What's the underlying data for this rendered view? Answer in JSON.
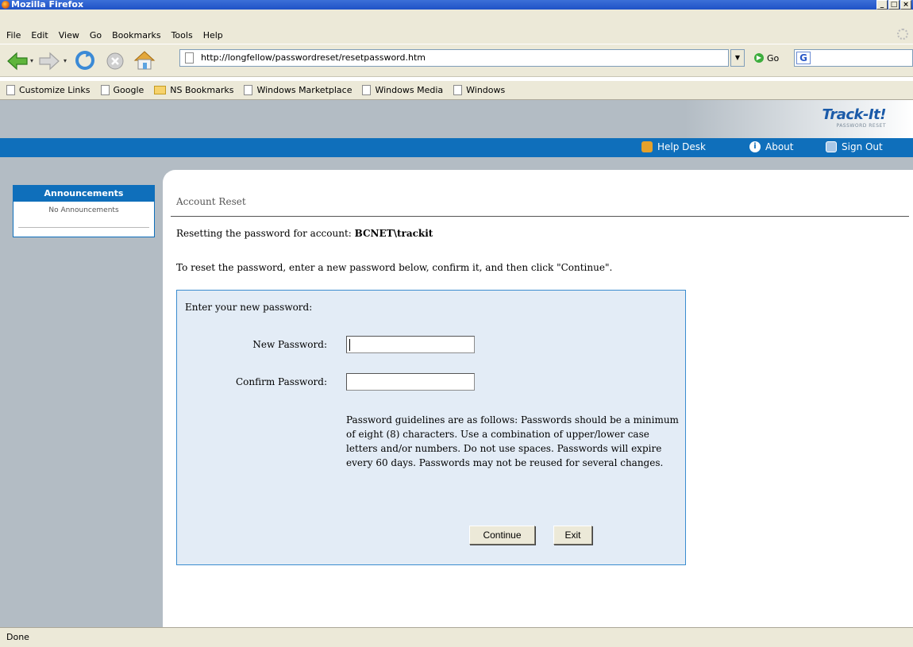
{
  "window": {
    "title": "Mozilla Firefox"
  },
  "menu": {
    "items": [
      "File",
      "Edit",
      "View",
      "Go",
      "Bookmarks",
      "Tools",
      "Help"
    ]
  },
  "nav": {
    "url": "http://longfellow/passwordreset/resetpassword.htm",
    "go_label": "Go",
    "search_value": ""
  },
  "bookmarks": [
    {
      "label": "Customize Links",
      "icon": "page-icon"
    },
    {
      "label": "Google",
      "icon": "page-icon"
    },
    {
      "label": "NS Bookmarks",
      "icon": "folder-icon"
    },
    {
      "label": "Windows Marketplace",
      "icon": "page-icon"
    },
    {
      "label": "Windows Media",
      "icon": "page-icon"
    },
    {
      "label": "Windows",
      "icon": "page-icon"
    }
  ],
  "brand": {
    "name": "Track-It!",
    "tagline": "PASSWORD RESET"
  },
  "topnav": {
    "help_desk": "Help Desk",
    "about": "About",
    "sign_out": "Sign Out"
  },
  "announcements": {
    "title": "Announcements",
    "body": "No Announcements"
  },
  "main": {
    "section_title": "Account Reset",
    "reset_prefix": "Resetting the password for account: ",
    "account": "BCNET\\trackit",
    "instructions": "To reset the password, enter a new password below, confirm it, and then click \"Continue\".",
    "prompt": "Enter your new password:",
    "new_password_label": "New Password:",
    "confirm_password_label": "Confirm Password:",
    "new_password_value": "",
    "confirm_password_value": "",
    "guidelines": "Password guidelines are as follows: Passwords should be a minimum of eight (8) characters. Use a combination of upper/lower case letters and/or numbers. Do not use spaces. Passwords will expire every 60 days. Passwords may not be reused for several changes.",
    "continue_label": "Continue",
    "exit_label": "Exit"
  },
  "status": {
    "text": "Done"
  },
  "colors": {
    "accent_blue": "#0f6fbb",
    "panel_gray": "#b3bcc4",
    "form_bg": "#e3ecf6"
  }
}
